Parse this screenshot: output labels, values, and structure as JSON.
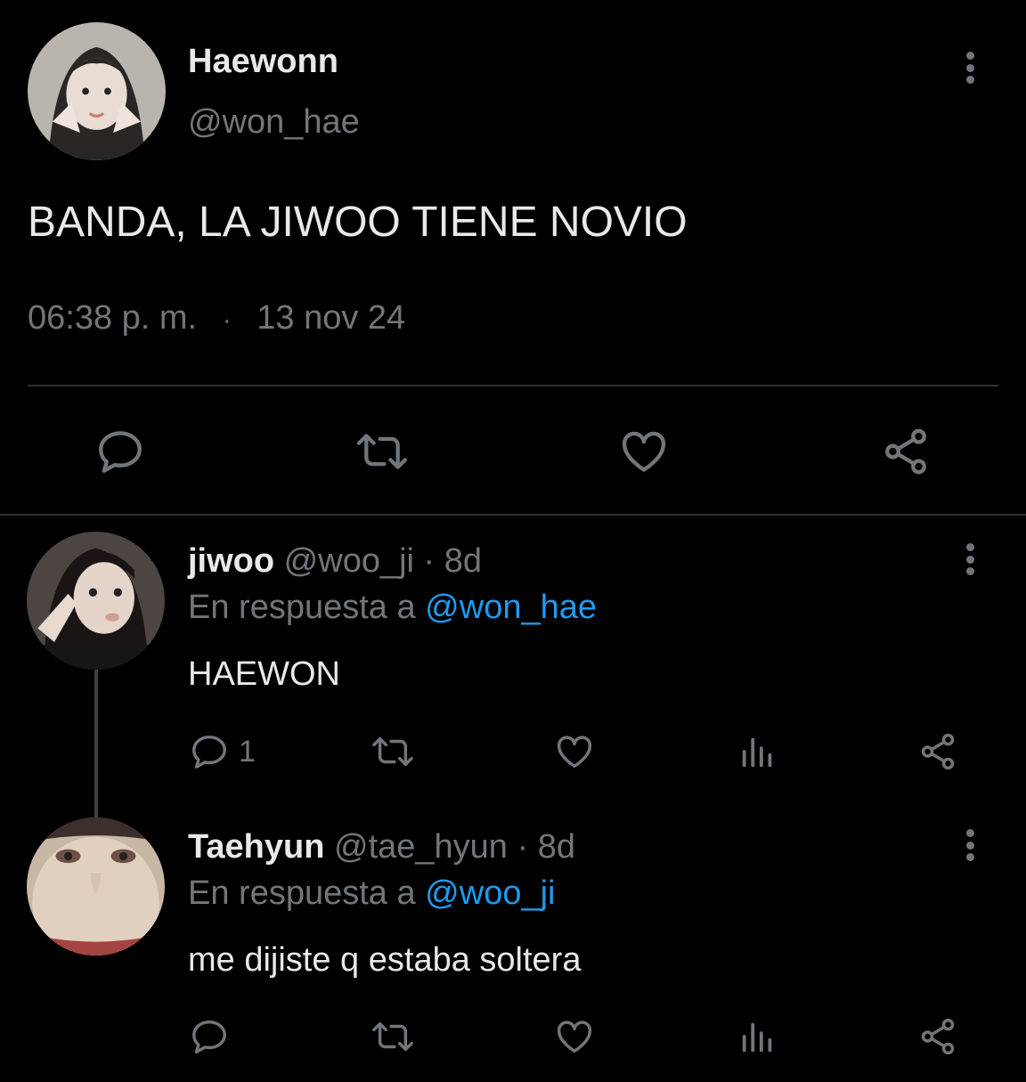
{
  "main_tweet": {
    "display_name": "Haewonn",
    "handle": "@won_hae",
    "text": "BANDA, LA JIWOO TIENE NOVIO",
    "time": "06:38 p. m.",
    "separator": "·",
    "date": "13 nov 24",
    "actions": [
      "reply-icon",
      "retweet-icon",
      "like-icon",
      "share-icon"
    ]
  },
  "replies": [
    {
      "display_name": "jiwoo",
      "handle": "@woo_ji",
      "age": "· 8d",
      "reply_prefix": "En respuesta a",
      "reply_to": "@won_hae",
      "text": "HAEWON",
      "reply_count": "1"
    },
    {
      "display_name": "Taehyun",
      "handle": "@tae_hyun",
      "age": "· 8d",
      "reply_prefix": "En respuesta a",
      "reply_to": "@woo_ji",
      "text": "me dijiste q estaba soltera",
      "reply_count": ""
    }
  ],
  "colors": {
    "background": "#000000",
    "text": "#e7e9ea",
    "secondary": "#71767b",
    "link": "#1d9bf0",
    "divider": "#2f3336"
  }
}
